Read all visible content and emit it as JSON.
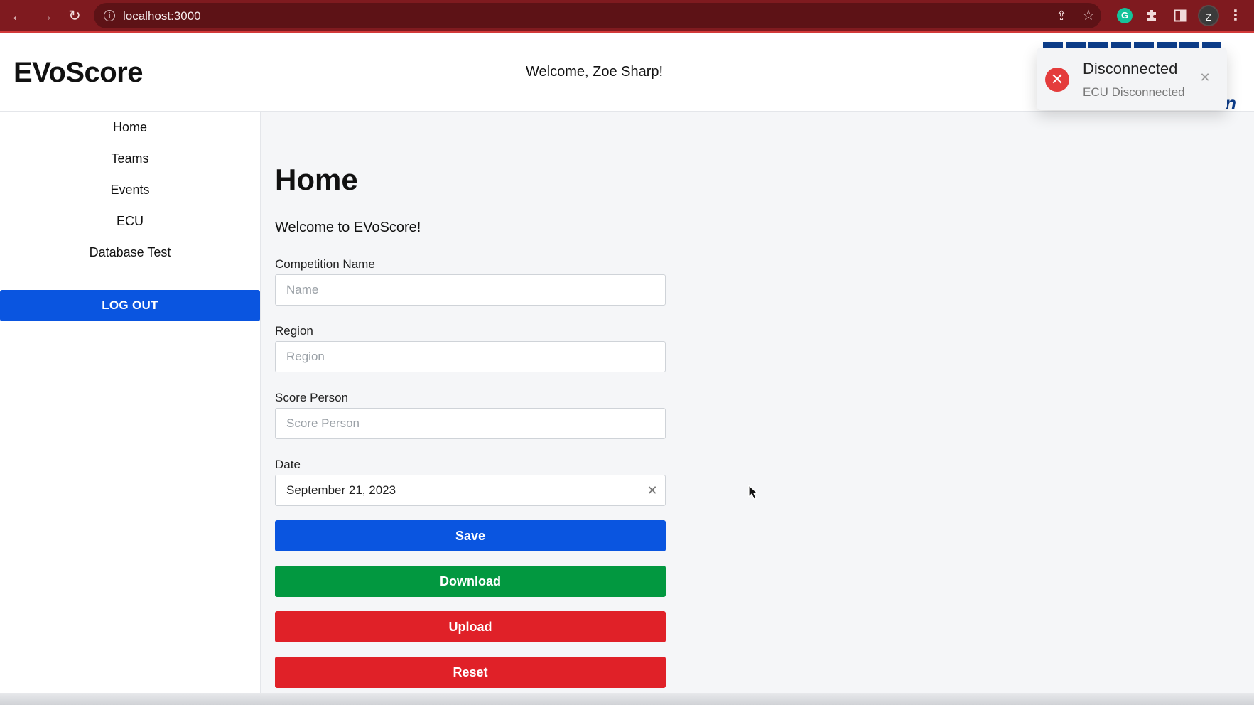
{
  "browser": {
    "url": "localhost:3000",
    "profile_initial": "Z"
  },
  "header": {
    "app_title": "EVoScore",
    "welcome_user": "Welcome, Zoe Sharp!",
    "logo_partial_text": "on"
  },
  "toast": {
    "title": "Disconnected",
    "message": "ECU Disconnected"
  },
  "sidebar": {
    "items": [
      {
        "label": "Home"
      },
      {
        "label": "Teams"
      },
      {
        "label": "Events"
      },
      {
        "label": "ECU"
      },
      {
        "label": "Database Test"
      }
    ],
    "logout_label": "LOG OUT"
  },
  "main": {
    "title": "Home",
    "welcome_text": "Welcome to EVoScore!",
    "fields": {
      "competition_name": {
        "label": "Competition Name",
        "placeholder": "Name",
        "value": ""
      },
      "region": {
        "label": "Region",
        "placeholder": "Region",
        "value": ""
      },
      "score_person": {
        "label": "Score Person",
        "placeholder": "Score Person",
        "value": ""
      },
      "date": {
        "label": "Date",
        "value": "September 21, 2023"
      }
    },
    "buttons": {
      "save": "Save",
      "download": "Download",
      "upload": "Upload",
      "reset": "Reset"
    }
  },
  "colors": {
    "browser_bar": "#7f1a1f",
    "primary_blue": "#0a55e0",
    "download_green": "#029840",
    "danger_red": "#e02128",
    "toast_error": "#e43c3c"
  }
}
